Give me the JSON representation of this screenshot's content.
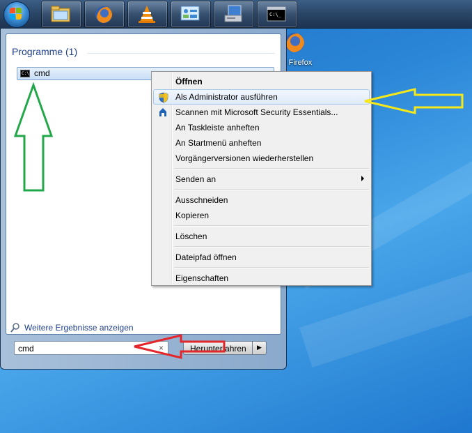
{
  "taskbar": {
    "items": [
      {
        "icon": "explorer-icon"
      },
      {
        "icon": "firefox-icon"
      },
      {
        "icon": "vlc-icon"
      },
      {
        "icon": "control-panel-icon"
      },
      {
        "icon": "computer-icon"
      },
      {
        "icon": "cmd-icon"
      }
    ]
  },
  "desktop": {
    "firefox_label": "la Firefox"
  },
  "start_menu": {
    "section_header": "Programme (1)",
    "result_item": "cmd",
    "more_results": "Weitere Ergebnisse anzeigen",
    "search_value": "cmd",
    "search_clear": "×",
    "shutdown_label": "Herunterfahren",
    "shutdown_arrow": "▶"
  },
  "context_menu": {
    "items": [
      {
        "label": "Öffnen"
      },
      {
        "label": "Als Administrator ausführen"
      },
      {
        "label": "Scannen mit Microsoft Security Essentials..."
      },
      {
        "label": "An Taskleiste anheften"
      },
      {
        "label": "An Startmenü anheften"
      },
      {
        "label": "Vorgängerversionen wiederherstellen"
      },
      {
        "label": "Senden an"
      },
      {
        "label": "Ausschneiden"
      },
      {
        "label": "Kopieren"
      },
      {
        "label": "Löschen"
      },
      {
        "label": "Dateipfad öffnen"
      },
      {
        "label": "Eigenschaften"
      }
    ]
  },
  "annotations": {
    "green_arrow_color": "#22a84a",
    "yellow_arrow_color": "#f4e81a",
    "red_arrow_color": "#e3262a"
  }
}
